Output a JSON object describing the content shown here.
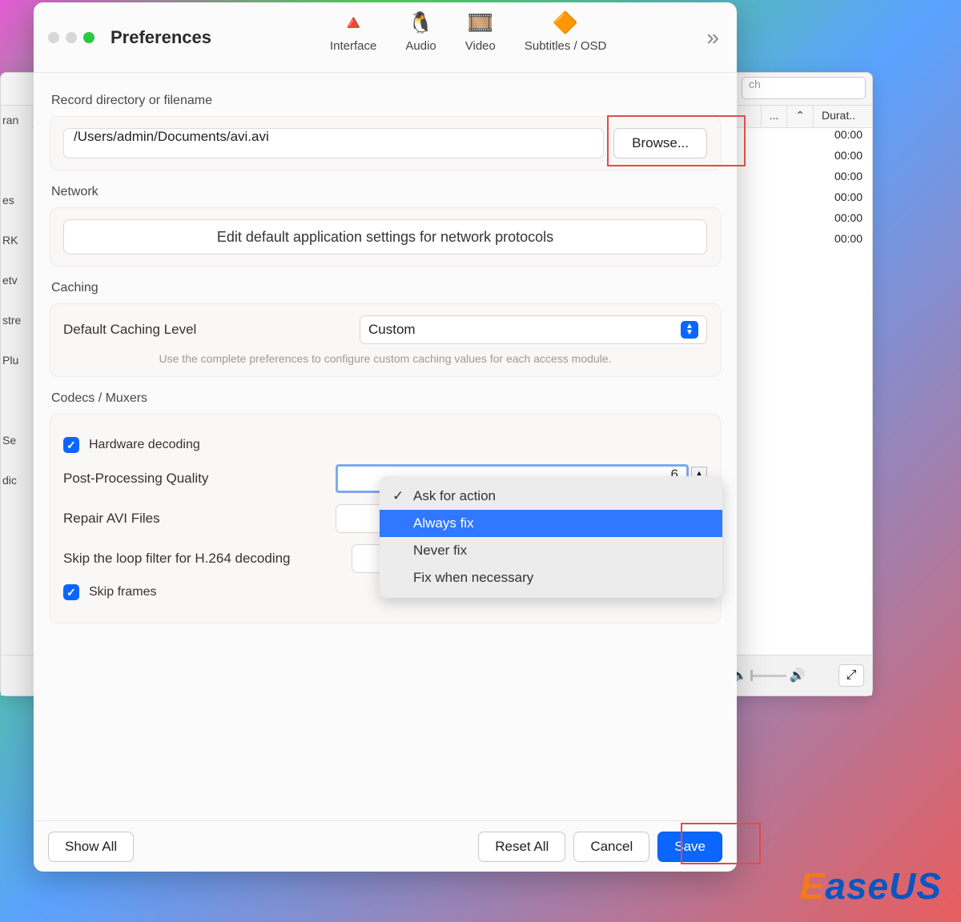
{
  "window": {
    "title": "Preferences"
  },
  "tabs": {
    "interface": "Interface",
    "audio": "Audio",
    "video": "Video",
    "subtitles": "Subtitles / OSD"
  },
  "record": {
    "sectionLabel": "Record directory or filename",
    "path": "/Users/admin/Documents/avi.avi",
    "browse": "Browse..."
  },
  "network": {
    "sectionLabel": "Network",
    "editButton": "Edit default application settings for network protocols"
  },
  "caching": {
    "sectionLabel": "Caching",
    "levelLabel": "Default Caching Level",
    "levelValue": "Custom",
    "hint": "Use the complete preferences to configure custom caching values for each access module."
  },
  "codecs": {
    "sectionLabel": "Codecs / Muxers",
    "hardwareDecoding": "Hardware decoding",
    "ppLabel": "Post-Processing Quality",
    "ppValue": "6",
    "repairLabel": "Repair AVI Files",
    "skipLoopLabel": "Skip the loop filter for H.264 decoding",
    "skipFrames": "Skip frames",
    "repairOptions": {
      "ask": "Ask for action",
      "always": "Always fix",
      "never": "Never fix",
      "whenNecessary": "Fix when necessary"
    }
  },
  "footer": {
    "showAll": "Show All",
    "resetAll": "Reset All",
    "cancel": "Cancel",
    "save": "Save"
  },
  "bg": {
    "searchPlaceholder": "ch",
    "col_more": "...",
    "col_up": "⌃",
    "col_dur": "Durat..",
    "durations": [
      "00:00",
      "00:00",
      "00:00",
      "00:00",
      "00:00",
      "00:00"
    ],
    "sidebar": [
      "ran",
      "",
      "es",
      "RK",
      "etv",
      "stre",
      "Plu",
      "",
      "Se",
      "dic"
    ]
  },
  "watermark": {
    "e": "E",
    "rest": "aseUS"
  }
}
